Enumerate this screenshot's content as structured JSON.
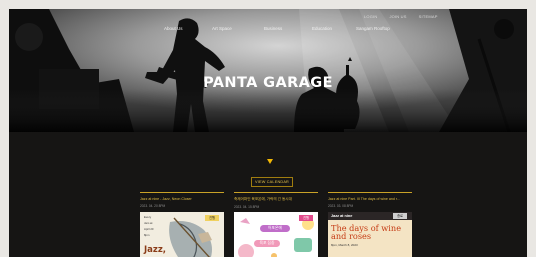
{
  "header": {
    "utility_links": [
      "LOGIN",
      "JOIN US",
      "SITEMAP"
    ],
    "nav": [
      "About Us",
      "Art Space",
      "Business",
      "Education",
      "Sangam Rooftop"
    ],
    "hero_title": "PANTA GARAGE"
  },
  "calendar": {
    "button_label": "VIEW CALENDAR"
  },
  "cards": [
    {
      "title": "Jazz at nine - Jazz, Neon Closer",
      "date": "2023. 04. 20 8PM",
      "tag": "진행",
      "poster": {
        "l1": "Every",
        "l2": "Jam at",
        "l3": "April 20",
        "l4": "8pm",
        "big": "Jazz,"
      }
    },
    {
      "title": "축제어파인 육포온에, 가락의 긴 동시대",
      "date": "2023. 04. 15 8PM",
      "tag": "진행",
      "poster": {
        "pill1": "어포온에",
        "pill2": "육포 집중"
      }
    },
    {
      "title": "Jazz at nine Part. III The days of wine and r...",
      "date": "2023. 03. 08 8PM",
      "tag": "종료",
      "poster": {
        "head": "Jazz at nine",
        "l1": "The days of wine",
        "l2": "and roses",
        "sub": "8pm, March 8, 2023"
      }
    }
  ],
  "colors": {
    "accent": "#f2b705",
    "background": "#161514"
  }
}
